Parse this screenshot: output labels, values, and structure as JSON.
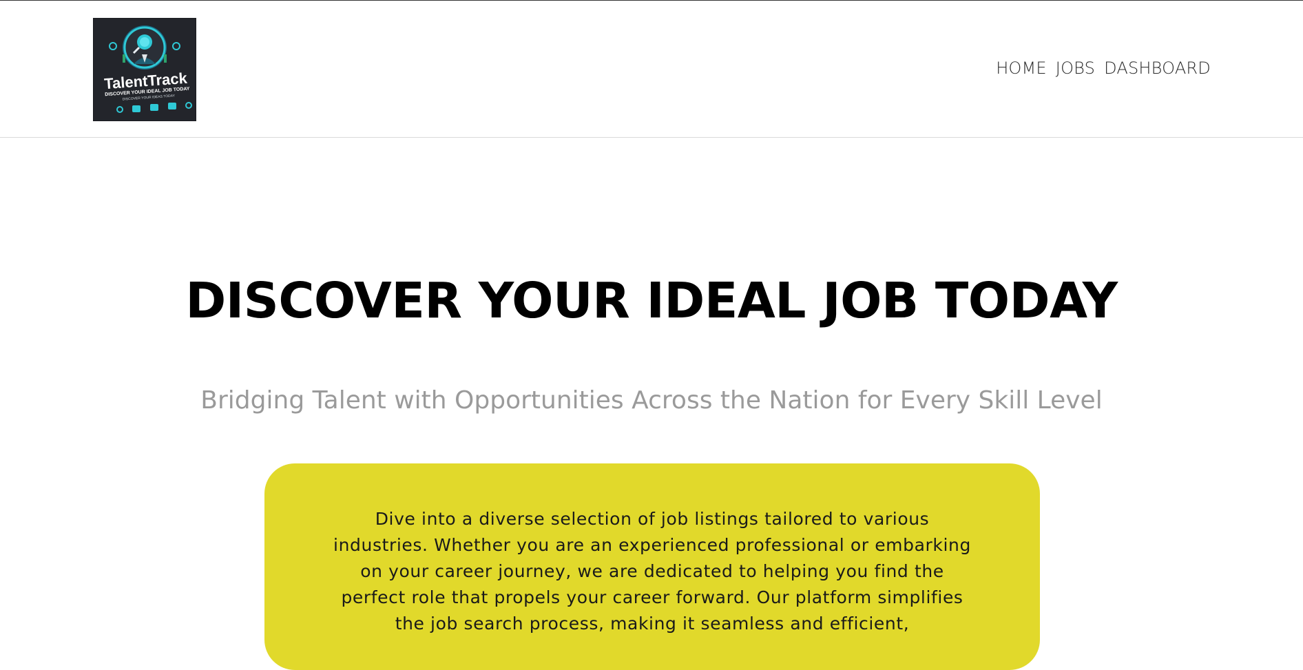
{
  "header": {
    "logo": {
      "brand": "TalentTrack",
      "tagline": "DISCOVER YOUR IDEAL JOB TODAY",
      "subtagline": "DISCOVER YOUR IDEAS TODAY"
    },
    "nav": [
      {
        "label": "HOME"
      },
      {
        "label": "JOBS"
      },
      {
        "label": "DASHBOARD"
      }
    ]
  },
  "hero": {
    "title": "DISCOVER YOUR IDEAL JOB TODAY",
    "subtitle": "Bridging Talent with Opportunities Across the Nation for Every Skill Level"
  },
  "info_card": {
    "text": "Dive into a diverse selection of job listings tailored to various industries. Whether you are an experienced professional or embarking on your career journey, we are dedicated to helping you find the perfect role that propels your career forward. Our platform simplifies the job search process, making it seamless and efficient,"
  },
  "colors": {
    "accent_yellow": "#e1d92b",
    "subtitle_gray": "#9a9a9a",
    "logo_bg": "#23252b",
    "logo_teal": "#2fc9d6"
  }
}
